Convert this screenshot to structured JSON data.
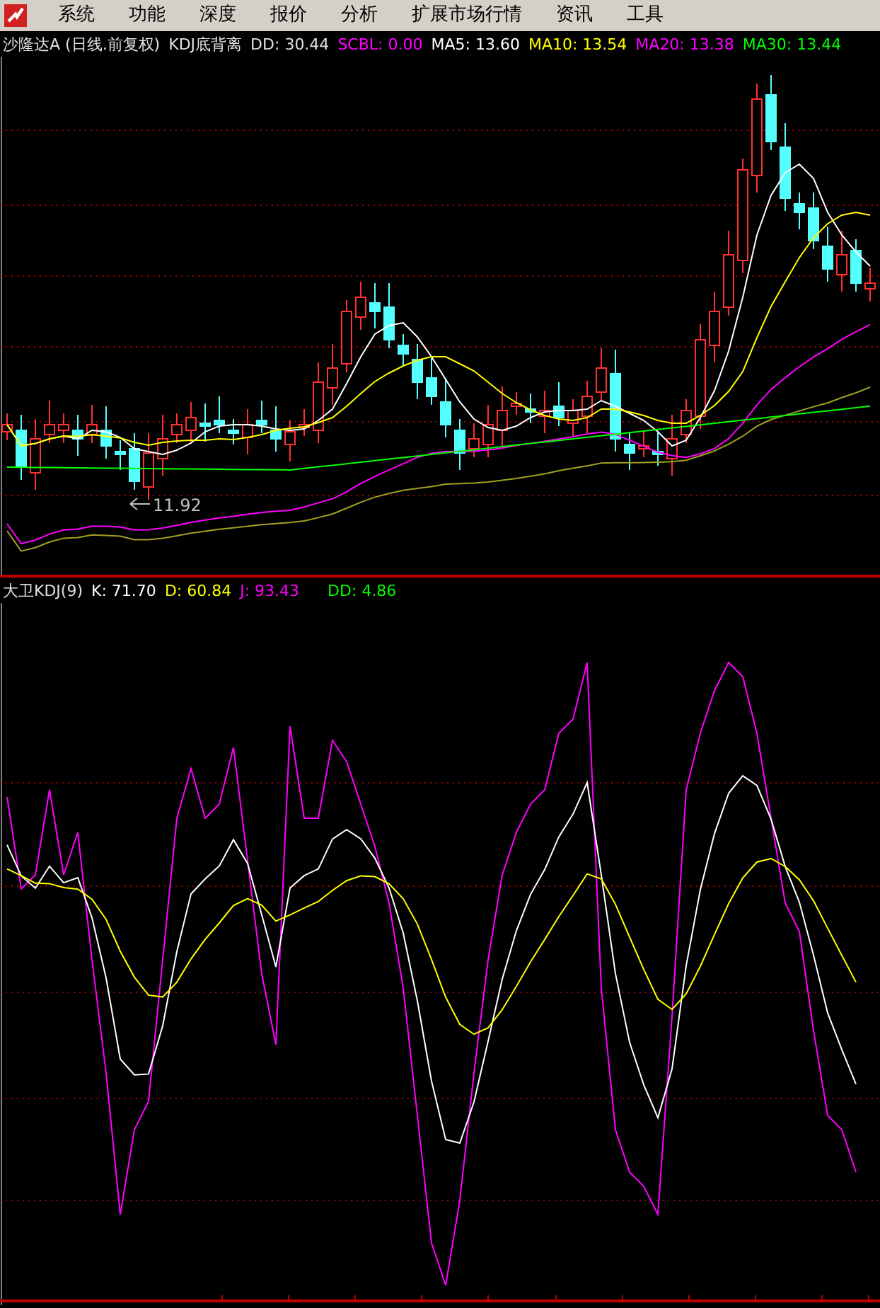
{
  "menu": {
    "items": [
      "系统",
      "功能",
      "深度",
      "报价",
      "分析",
      "扩展市场行情",
      "资讯",
      "工具"
    ]
  },
  "price_chart": {
    "legend": [
      {
        "text": "沙隆达A (日线.前复权)",
        "color": "#e0e0e0"
      },
      {
        "text": "KDJ底背离",
        "color": "#e0e0e0"
      },
      {
        "text": "DD: 30.44",
        "color": "#e0e0e0"
      },
      {
        "text": "SCBL: 0.00",
        "color": "#ff00ff"
      },
      {
        "text": "MA5: 13.60",
        "color": "#ffffff"
      },
      {
        "text": "MA10: 13.54",
        "color": "#ffff00"
      },
      {
        "text": "MA20: 13.38",
        "color": "#ff00ff"
      },
      {
        "text": "MA30: 13.44",
        "color": "#00ff00"
      }
    ],
    "low_label": "11.92"
  },
  "kdj_chart": {
    "legend": [
      {
        "text": "大卫KDJ(9)",
        "color": "#e0e0e0"
      },
      {
        "text": "K: 71.70",
        "color": "#ffffff"
      },
      {
        "text": "D: 60.84",
        "color": "#ffff00"
      },
      {
        "text": "J: 93.43",
        "color": "#ff00ff"
      },
      {
        "text": "DD: 4.86",
        "color": "#00ff00"
      }
    ]
  }
}
